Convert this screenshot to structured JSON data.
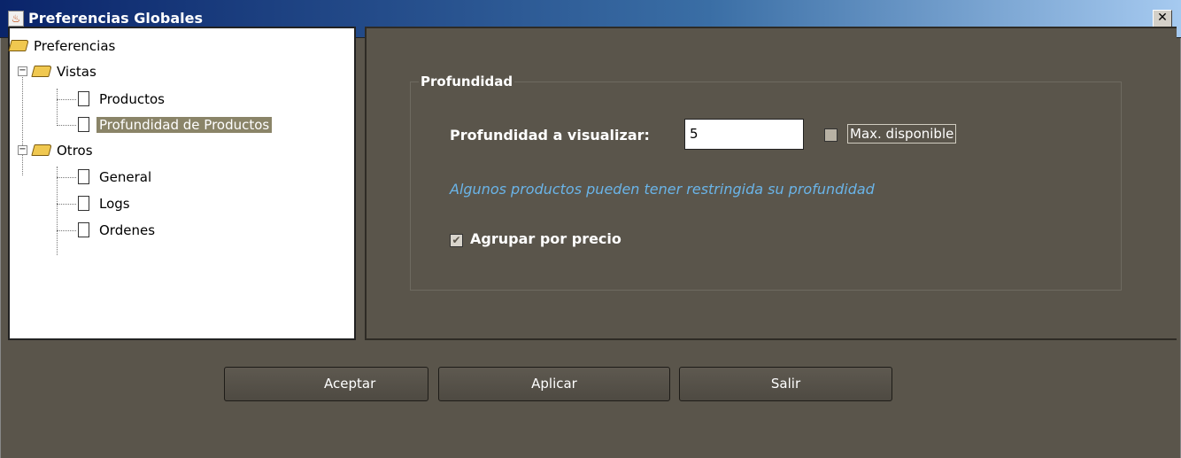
{
  "window": {
    "title": "Preferencias Globales",
    "close_symbol": "✕"
  },
  "tree": {
    "root": "Preferencias",
    "vistas": "Vistas",
    "productos": "Productos",
    "profundidad_productos": "Profundidad de Productos",
    "otros": "Otros",
    "general": "General",
    "logs": "Logs",
    "ordenes": "Ordenes"
  },
  "panel": {
    "group_title": "Profundidad",
    "depth_label": "Profundidad a visualizar:",
    "depth_value": "5",
    "max_label": "Max. disponible",
    "max_checked": false,
    "info_text": "Algunos productos pueden tener restringida su profundidad",
    "group_by_price_label": "Agrupar por precio",
    "group_by_price_checked": true
  },
  "buttons": {
    "accept": "Aceptar",
    "apply": "Aplicar",
    "exit": "Salir"
  },
  "colors": {
    "background": "#5a554b",
    "selection": "#8a8468",
    "info_text": "#6ab4e8"
  }
}
